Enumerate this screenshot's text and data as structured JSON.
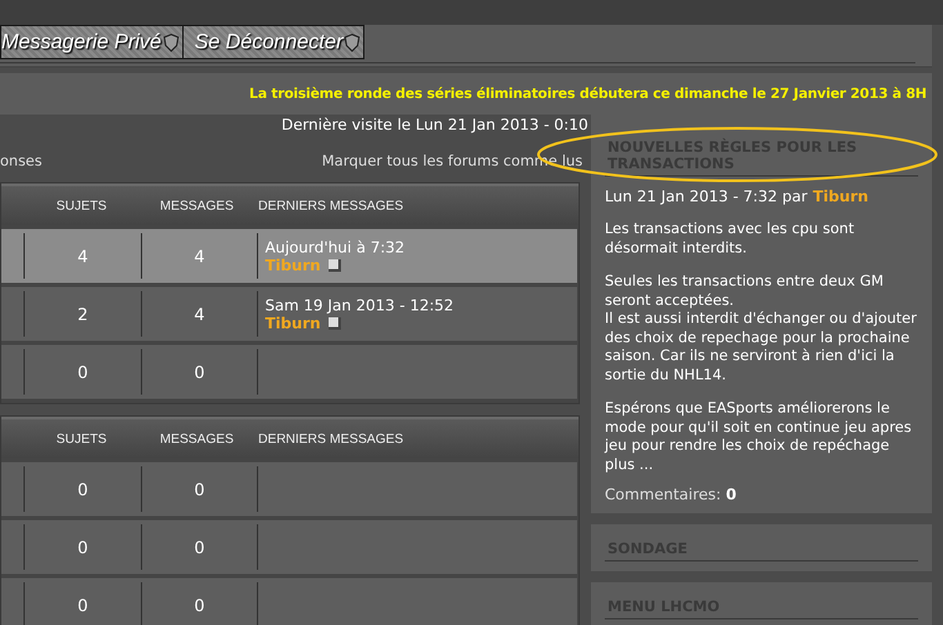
{
  "nav": {
    "buttons": [
      {
        "label": "Messagerie Privé"
      },
      {
        "label": "Se Déconnecter"
      }
    ]
  },
  "announcement": "La troisième ronde des séries éliminatoires débutera ce dimanche le 27 Janvier 2013 à 8H",
  "last_visit": "Dernière visite le Lun 21 Jan 2013 - 0:10",
  "links": {
    "left": "onses",
    "right": "Marquer tous les forums comme lus"
  },
  "forums": [
    {
      "columns": [
        "SUJETS",
        "MESSAGES",
        "DERNIERS MESSAGES"
      ],
      "rows": [
        {
          "topics": "4",
          "posts": "4",
          "highlighted": true,
          "last_date": "Aujourd'hui à 7:32",
          "last_author": "Tiburn"
        },
        {
          "topics": "2",
          "posts": "4",
          "highlighted": false,
          "last_date": "Sam 19 Jan 2013 - 12:52",
          "last_author": "Tiburn"
        },
        {
          "topics": "0",
          "posts": "0",
          "highlighted": false
        }
      ]
    },
    {
      "columns": [
        "SUJETS",
        "MESSAGES",
        "DERNIERS MESSAGES"
      ],
      "rows": [
        {
          "topics": "0",
          "posts": "0",
          "highlighted": false
        },
        {
          "topics": "0",
          "posts": "0",
          "highlighted": false
        },
        {
          "topics": "0",
          "posts": "0",
          "highlighted": false
        }
      ]
    }
  ],
  "sidebar": [
    {
      "kind": "article",
      "title": "NOUVELLES RÈGLES POUR LES TRANSACTIONS",
      "meta": "Lun 21 Jan 2013 - 7:32 par",
      "author": "Tiburn",
      "blocks": [
        [
          "Les transactions avec les cpu sont désormait interdits."
        ],
        [
          "Seules les transactions entre deux GM seront acceptées.",
          "Il est aussi interdit d'échanger ou d'ajouter des choix de repechage pour la prochaine saison. Car ils ne serviront à rien d'ici la sortie du NHL14."
        ],
        [
          "Espérons que EASports améliorerons le mode pour qu'il soit en continue jeu apres jeu pour rendre les choix de repéchage plus ..."
        ]
      ],
      "comments": "Commentaires: **0**"
    },
    {
      "kind": "heading",
      "title": "SONDAGE"
    },
    {
      "kind": "heading",
      "title": "MENU LHCMO"
    }
  ]
}
